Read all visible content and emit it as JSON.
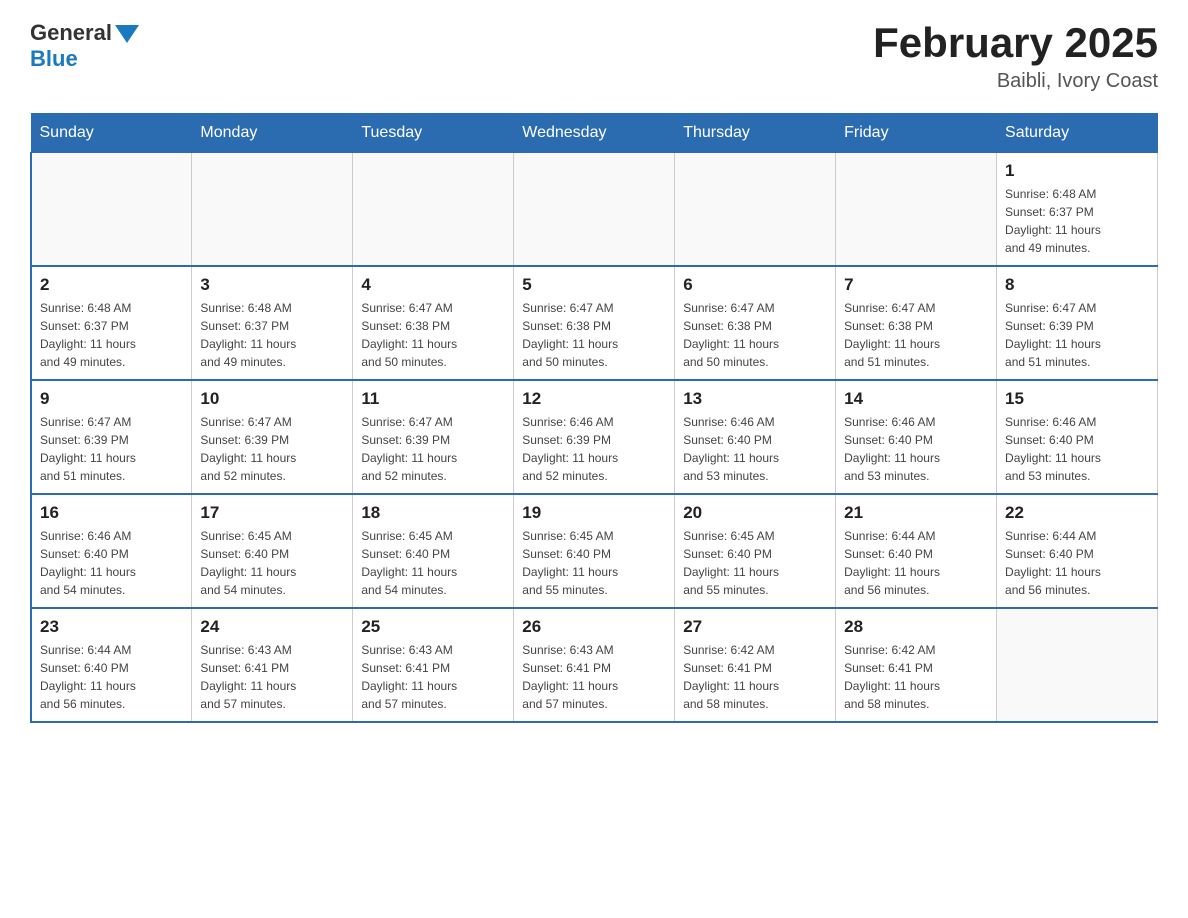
{
  "header": {
    "logo_general": "General",
    "logo_blue": "Blue",
    "title": "February 2025",
    "subtitle": "Baibli, Ivory Coast"
  },
  "days_of_week": [
    "Sunday",
    "Monday",
    "Tuesday",
    "Wednesday",
    "Thursday",
    "Friday",
    "Saturday"
  ],
  "weeks": [
    [
      {
        "day": "",
        "info": ""
      },
      {
        "day": "",
        "info": ""
      },
      {
        "day": "",
        "info": ""
      },
      {
        "day": "",
        "info": ""
      },
      {
        "day": "",
        "info": ""
      },
      {
        "day": "",
        "info": ""
      },
      {
        "day": "1",
        "info": "Sunrise: 6:48 AM\nSunset: 6:37 PM\nDaylight: 11 hours\nand 49 minutes."
      }
    ],
    [
      {
        "day": "2",
        "info": "Sunrise: 6:48 AM\nSunset: 6:37 PM\nDaylight: 11 hours\nand 49 minutes."
      },
      {
        "day": "3",
        "info": "Sunrise: 6:48 AM\nSunset: 6:37 PM\nDaylight: 11 hours\nand 49 minutes."
      },
      {
        "day": "4",
        "info": "Sunrise: 6:47 AM\nSunset: 6:38 PM\nDaylight: 11 hours\nand 50 minutes."
      },
      {
        "day": "5",
        "info": "Sunrise: 6:47 AM\nSunset: 6:38 PM\nDaylight: 11 hours\nand 50 minutes."
      },
      {
        "day": "6",
        "info": "Sunrise: 6:47 AM\nSunset: 6:38 PM\nDaylight: 11 hours\nand 50 minutes."
      },
      {
        "day": "7",
        "info": "Sunrise: 6:47 AM\nSunset: 6:38 PM\nDaylight: 11 hours\nand 51 minutes."
      },
      {
        "day": "8",
        "info": "Sunrise: 6:47 AM\nSunset: 6:39 PM\nDaylight: 11 hours\nand 51 minutes."
      }
    ],
    [
      {
        "day": "9",
        "info": "Sunrise: 6:47 AM\nSunset: 6:39 PM\nDaylight: 11 hours\nand 51 minutes."
      },
      {
        "day": "10",
        "info": "Sunrise: 6:47 AM\nSunset: 6:39 PM\nDaylight: 11 hours\nand 52 minutes."
      },
      {
        "day": "11",
        "info": "Sunrise: 6:47 AM\nSunset: 6:39 PM\nDaylight: 11 hours\nand 52 minutes."
      },
      {
        "day": "12",
        "info": "Sunrise: 6:46 AM\nSunset: 6:39 PM\nDaylight: 11 hours\nand 52 minutes."
      },
      {
        "day": "13",
        "info": "Sunrise: 6:46 AM\nSunset: 6:40 PM\nDaylight: 11 hours\nand 53 minutes."
      },
      {
        "day": "14",
        "info": "Sunrise: 6:46 AM\nSunset: 6:40 PM\nDaylight: 11 hours\nand 53 minutes."
      },
      {
        "day": "15",
        "info": "Sunrise: 6:46 AM\nSunset: 6:40 PM\nDaylight: 11 hours\nand 53 minutes."
      }
    ],
    [
      {
        "day": "16",
        "info": "Sunrise: 6:46 AM\nSunset: 6:40 PM\nDaylight: 11 hours\nand 54 minutes."
      },
      {
        "day": "17",
        "info": "Sunrise: 6:45 AM\nSunset: 6:40 PM\nDaylight: 11 hours\nand 54 minutes."
      },
      {
        "day": "18",
        "info": "Sunrise: 6:45 AM\nSunset: 6:40 PM\nDaylight: 11 hours\nand 54 minutes."
      },
      {
        "day": "19",
        "info": "Sunrise: 6:45 AM\nSunset: 6:40 PM\nDaylight: 11 hours\nand 55 minutes."
      },
      {
        "day": "20",
        "info": "Sunrise: 6:45 AM\nSunset: 6:40 PM\nDaylight: 11 hours\nand 55 minutes."
      },
      {
        "day": "21",
        "info": "Sunrise: 6:44 AM\nSunset: 6:40 PM\nDaylight: 11 hours\nand 56 minutes."
      },
      {
        "day": "22",
        "info": "Sunrise: 6:44 AM\nSunset: 6:40 PM\nDaylight: 11 hours\nand 56 minutes."
      }
    ],
    [
      {
        "day": "23",
        "info": "Sunrise: 6:44 AM\nSunset: 6:40 PM\nDaylight: 11 hours\nand 56 minutes."
      },
      {
        "day": "24",
        "info": "Sunrise: 6:43 AM\nSunset: 6:41 PM\nDaylight: 11 hours\nand 57 minutes."
      },
      {
        "day": "25",
        "info": "Sunrise: 6:43 AM\nSunset: 6:41 PM\nDaylight: 11 hours\nand 57 minutes."
      },
      {
        "day": "26",
        "info": "Sunrise: 6:43 AM\nSunset: 6:41 PM\nDaylight: 11 hours\nand 57 minutes."
      },
      {
        "day": "27",
        "info": "Sunrise: 6:42 AM\nSunset: 6:41 PM\nDaylight: 11 hours\nand 58 minutes."
      },
      {
        "day": "28",
        "info": "Sunrise: 6:42 AM\nSunset: 6:41 PM\nDaylight: 11 hours\nand 58 minutes."
      },
      {
        "day": "",
        "info": ""
      }
    ]
  ]
}
